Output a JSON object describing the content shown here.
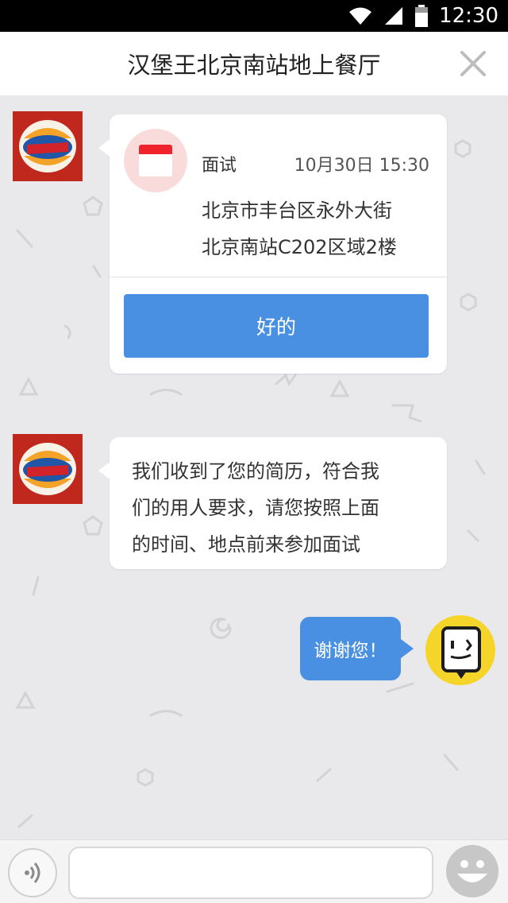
{
  "status_bar": {
    "time": "12:30",
    "icons": [
      "wifi-icon",
      "signal-icon",
      "battery-icon"
    ]
  },
  "header": {
    "title": "汉堡王北京南站地上餐厅",
    "close_icon": "close-icon"
  },
  "messages": {
    "interview_card": {
      "label": "面试",
      "datetime": "10月30日 15:30",
      "address_line1": "北京市丰台区永外大街",
      "address_line2": "北京南站C202区域2楼",
      "button_label": "好的"
    },
    "text_message": {
      "line1": "我们收到了您的简历，符合我",
      "line2": "们的用人要求，请您按照上面",
      "line3": "的时间、地点前来参加面试"
    },
    "user_reply": "谢谢您！"
  },
  "brand": {
    "logo_top": "BURGER",
    "logo_bottom": "KING"
  },
  "input_bar": {
    "placeholder": "",
    "voice_icon": "voice-icon",
    "emoji_icon": "emoji-icon"
  },
  "colors": {
    "accent": "#4a90e2",
    "brand_red": "#c0281e",
    "calendar_red": "#f0232c",
    "user_avatar_yellow": "#f6d52a"
  }
}
